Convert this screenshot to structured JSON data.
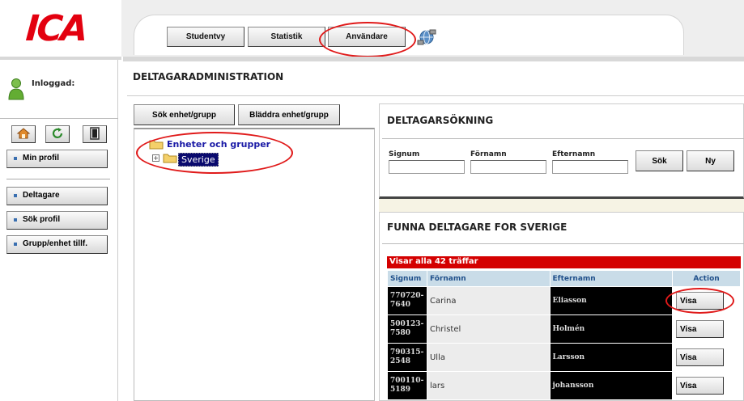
{
  "logo": {
    "text": "ICA"
  },
  "tabs": {
    "studentvy": "Studentvy",
    "statistik": "Statistik",
    "anvandare": "Användare"
  },
  "sidebar": {
    "logged_in_label": "Inloggad:",
    "buttons": {
      "min_profil": "Min profil",
      "deltagare": "Deltagare",
      "sok_profil": "Sök profil",
      "grupp_enhet": "Grupp/enhet tillf."
    }
  },
  "main": {
    "page_title": "DELTAGARADMINISTRATION",
    "sok_enhet_label": "Sök enhet/grupp",
    "bladdra_label": "Bläddra enhet/grupp",
    "tree": {
      "root_label": "Enheter och grupper",
      "child_label": "Sverige"
    }
  },
  "search": {
    "title": "DELTAGARSÖKNING",
    "signum_label": "Signum",
    "fornamn_label": "Förnamn",
    "efternamn_label": "Efternamn",
    "sok_label": "Sök",
    "ny_label": "Ny"
  },
  "results": {
    "title": "FUNNA DELTAGARE FOR SVERIGE",
    "count_text": "Visar alla 42 träffar",
    "columns": {
      "signum": "Signum",
      "fornamn": "Förnamn",
      "efternamn": "Efternamn",
      "action": "Action"
    },
    "rows": [
      {
        "signum": "770720-7640",
        "fornamn": "Carina",
        "efternamn": "Eliasson",
        "action": "Visa"
      },
      {
        "signum": "500123-7580",
        "fornamn": "Christel",
        "efternamn": "Holmén",
        "action": "Visa"
      },
      {
        "signum": "790315-2548",
        "fornamn": "Ulla",
        "efternamn": "Larsson",
        "action": "Visa"
      },
      {
        "signum": "700110-5189",
        "fornamn": "lars",
        "efternamn": "johansson",
        "action": "Visa"
      }
    ]
  },
  "icons": {
    "home": "home-icon",
    "refresh": "refresh-icon",
    "logout": "door-icon",
    "network": "network-icon",
    "user": "user-icon",
    "folder": "folder-icon"
  },
  "colors": {
    "brand_red": "#e3000f",
    "results_bar": "#d40000",
    "table_header": "#c9dce8",
    "tree_selected": "#0a0a6e",
    "annotation": "#e01a1a"
  }
}
